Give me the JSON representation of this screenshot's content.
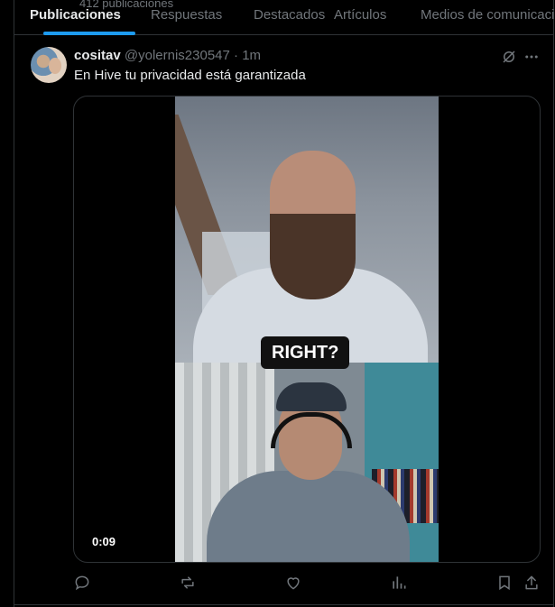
{
  "header": {
    "post_count": "412 publicaciones"
  },
  "tabs": [
    {
      "label": "Publicaciones",
      "active": true
    },
    {
      "label": "Respuestas",
      "active": false
    },
    {
      "label": "Destacados",
      "active": false
    },
    {
      "label": "Artículos",
      "active": false
    },
    {
      "label": "Medios de comunicación",
      "active": false
    }
  ],
  "tweet": {
    "author_name": "cositav",
    "author_handle": "@yolernis230547",
    "separator": "·",
    "time": "1m",
    "text": "En Hive tu privacidad está garantizada",
    "video": {
      "caption": "RIGHT?",
      "timestamp": "0:09"
    }
  },
  "icons": {
    "grok": "grok-icon",
    "more": "more-icon",
    "reply": "reply-icon",
    "repost": "repost-icon",
    "like": "like-icon",
    "views": "views-icon",
    "bookmark": "bookmark-icon",
    "share": "share-icon"
  },
  "colors": {
    "accent": "#1d9bf0",
    "muted": "#71767b",
    "text": "#e7e9ea",
    "border": "#2f3336"
  }
}
